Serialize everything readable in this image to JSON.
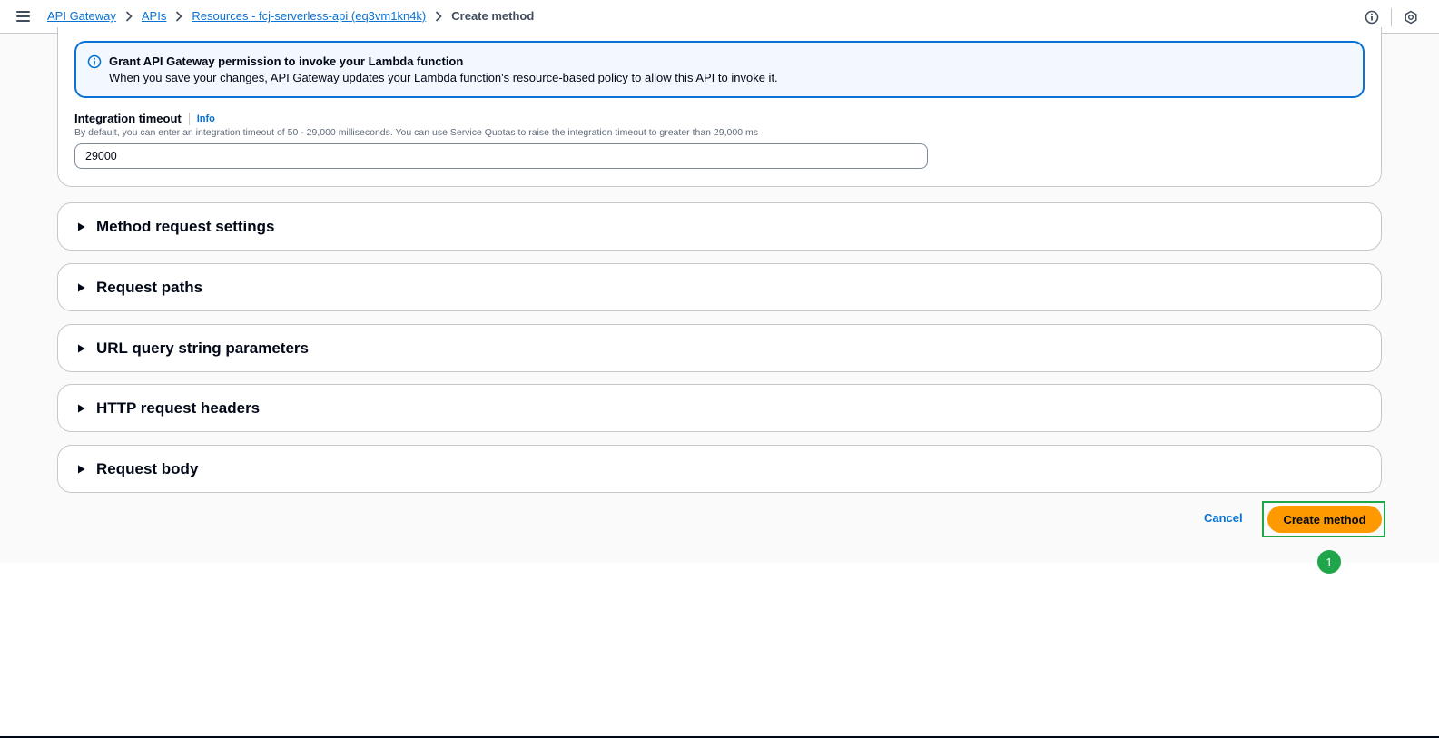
{
  "header": {
    "breadcrumb": [
      {
        "label": "API Gateway"
      },
      {
        "label": "APIs"
      },
      {
        "label": "Resources - fcj-serverless-api (eq3vm1kn4k)"
      }
    ],
    "current": "Create method",
    "icons": [
      "menu-icon",
      "info-icon",
      "notifications-icon"
    ]
  },
  "alert": {
    "title": "Grant API Gateway permission to invoke your Lambda function",
    "body": "When you save your changes, API Gateway updates your Lambda function's resource-based policy to allow this API to invoke it.",
    "icon": "info-circle-icon",
    "accent": "#0972d3"
  },
  "integration_timeout": {
    "label": "Integration timeout",
    "info": "Info",
    "description": "By default, you can enter an integration timeout of 50 - 29,000 milliseconds. You can use Service Quotas to raise the integration timeout to greater than 29,000 ms",
    "value": "29000"
  },
  "sections": [
    {
      "title": "Method request settings"
    },
    {
      "title": "Request paths"
    },
    {
      "title": "URL query string parameters"
    },
    {
      "title": "HTTP request headers"
    },
    {
      "title": "Request body"
    }
  ],
  "actions": {
    "cancel": "Cancel",
    "create": "Create method",
    "primary_color": "#ff9900"
  },
  "annotation": {
    "step": "1",
    "color": "#1fa64a"
  }
}
